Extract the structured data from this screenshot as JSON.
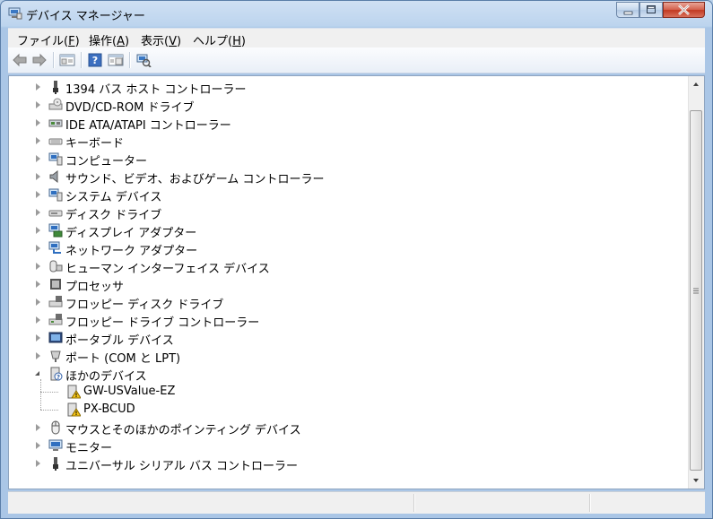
{
  "window": {
    "title": "デバイス マネージャー"
  },
  "menu": [
    {
      "label": "ファイル(",
      "key": "F",
      "end": ")"
    },
    {
      "label": "操作(",
      "key": "A",
      "end": ")"
    },
    {
      "label": "表示(",
      "key": "V",
      "end": ")"
    },
    {
      "label": "ヘルプ(",
      "key": "H",
      "end": ")"
    }
  ],
  "toolbar": [
    "back-icon",
    "forward-icon",
    "properties-icon",
    "help-icon",
    "view-icon",
    "scan-hardware-icon"
  ],
  "tree": [
    {
      "label": "1394 バス ホスト コントローラー",
      "icon": "1394-controller-icon",
      "expanded": false
    },
    {
      "label": "DVD/CD-ROM ドライブ",
      "icon": "dvd-drive-icon",
      "expanded": false
    },
    {
      "label": "IDE ATA/ATAPI コントローラー",
      "icon": "ide-controller-icon",
      "expanded": false
    },
    {
      "label": "キーボード",
      "icon": "keyboard-icon",
      "expanded": false
    },
    {
      "label": "コンピューター",
      "icon": "computer-icon",
      "expanded": false
    },
    {
      "label": "サウンド、ビデオ、およびゲーム コントローラー",
      "icon": "sound-icon",
      "expanded": false
    },
    {
      "label": "システム デバイス",
      "icon": "system-device-icon",
      "expanded": false
    },
    {
      "label": "ディスク ドライブ",
      "icon": "disk-drive-icon",
      "expanded": false
    },
    {
      "label": "ディスプレイ アダプター",
      "icon": "display-adapter-icon",
      "expanded": false
    },
    {
      "label": "ネットワーク アダプター",
      "icon": "network-adapter-icon",
      "expanded": false
    },
    {
      "label": "ヒューマン インターフェイス デバイス",
      "icon": "hid-icon",
      "expanded": false
    },
    {
      "label": "プロセッサ",
      "icon": "processor-icon",
      "expanded": false
    },
    {
      "label": "フロッピー ディスク ドライブ",
      "icon": "floppy-drive-icon",
      "expanded": false
    },
    {
      "label": "フロッピー ドライブ コントローラー",
      "icon": "floppy-controller-icon",
      "expanded": false
    },
    {
      "label": "ポータブル デバイス",
      "icon": "portable-device-icon",
      "expanded": false
    },
    {
      "label": "ポート (COM と LPT)",
      "icon": "port-icon",
      "expanded": false
    },
    {
      "label": "ほかのデバイス",
      "icon": "other-devices-icon",
      "expanded": true
    },
    {
      "label": "GW-USValue-EZ",
      "icon": "warning-device-icon",
      "child": true
    },
    {
      "label": "PX-BCUD",
      "icon": "warning-device-icon",
      "child": true
    },
    {
      "label": "マウスとそのほかのポインティング デバイス",
      "icon": "mouse-icon",
      "expanded": false
    },
    {
      "label": "モニター",
      "icon": "monitor-icon",
      "expanded": false
    },
    {
      "label": "ユニバーサル シリアル バス コントローラー",
      "icon": "usb-controller-icon",
      "expanded": false
    }
  ],
  "colors": {
    "frame": "#b9d1ea",
    "close": "#c94a33"
  }
}
